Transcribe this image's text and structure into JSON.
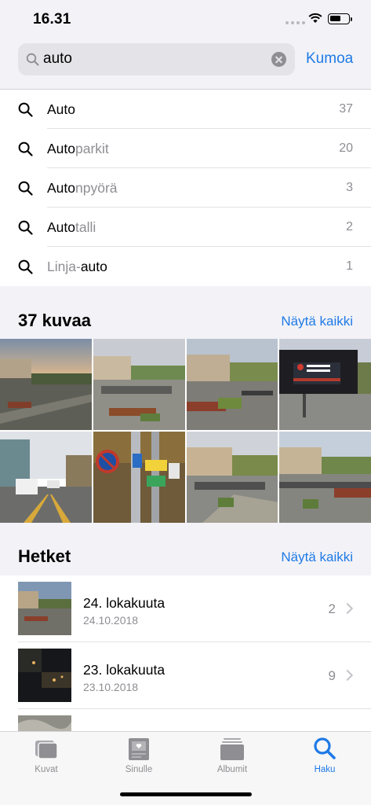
{
  "status_bar": {
    "time": "16.31"
  },
  "search": {
    "query": "auto",
    "cancel_label": "Kumoa"
  },
  "suggestions": [
    {
      "match": "Auto",
      "rest_before": "",
      "rest_after": "",
      "count": "37"
    },
    {
      "match": "Auto",
      "rest_before": "",
      "rest_after": "parkit",
      "count": "20"
    },
    {
      "match": "Auto",
      "rest_before": "",
      "rest_after": "npyörä",
      "count": "3"
    },
    {
      "match": "Auto",
      "rest_before": "",
      "rest_after": "talli",
      "count": "2"
    },
    {
      "match": "auto",
      "rest_before": "Linja-",
      "rest_after": "",
      "count": "1"
    }
  ],
  "photos_section": {
    "title": "37 kuvaa",
    "show_all": "Näytä kaikki"
  },
  "moments_section": {
    "title": "Hetket",
    "show_all": "Näytä kaikki",
    "items": [
      {
        "title": "24. lokakuuta",
        "date": "24.10.2018",
        "count": "2"
      },
      {
        "title": "23. lokakuuta",
        "date": "23.10.2018",
        "count": "9"
      }
    ]
  },
  "tabbar": {
    "items": [
      {
        "label": "Kuvat",
        "icon": "photos-icon"
      },
      {
        "label": "Sinulle",
        "icon": "for-you-icon"
      },
      {
        "label": "Albumit",
        "icon": "albums-icon"
      },
      {
        "label": "Haku",
        "icon": "search-icon"
      }
    ],
    "active": "Haku"
  },
  "theme": {
    "accent": "#1f7ae6",
    "secondary_text": "#8e8e93"
  }
}
